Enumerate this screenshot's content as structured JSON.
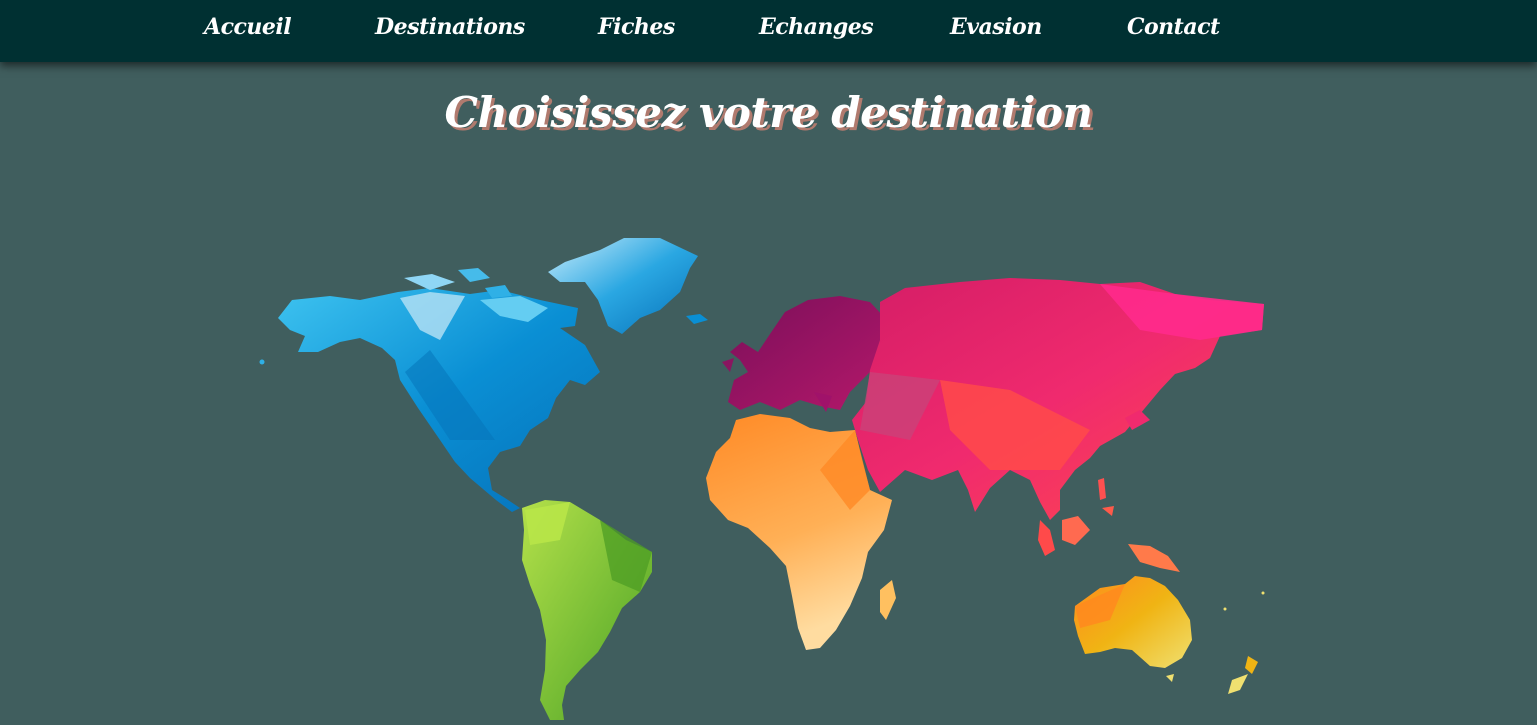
{
  "nav": {
    "items": [
      {
        "label": "Accueil"
      },
      {
        "label": "Destinations"
      },
      {
        "label": "Fiches"
      },
      {
        "label": "Echanges"
      },
      {
        "label": "Evasion"
      },
      {
        "label": "Contact"
      }
    ]
  },
  "main": {
    "title": "Choisissez votre destination"
  },
  "colors": {
    "navbar": "#003032",
    "background": "#405e5e",
    "north_america": "#0a9ad8",
    "south_america": "#7cc23a",
    "europe": "#8a1660",
    "africa": "#ff9a3c",
    "asia": "#f02a6e",
    "oceania": "#f0b414"
  }
}
